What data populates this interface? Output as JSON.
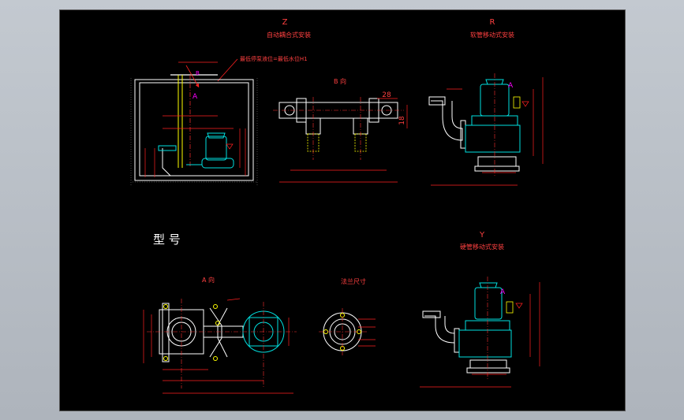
{
  "views": {
    "z": {
      "letter": "Z",
      "subtitle": "自动耦合式安装",
      "note": "最低停泵液位=最低水位H1"
    },
    "r": {
      "letter": "R",
      "subtitle": "软管移动式安装"
    },
    "y": {
      "letter": "Y",
      "subtitle": "硬管移动式安装"
    },
    "b": {
      "label": "B 向",
      "dim_28": "28",
      "dim_18": "18"
    },
    "a": {
      "label": "A 向"
    },
    "flange": {
      "label": "法兰尺寸"
    }
  },
  "model_label": "型 号",
  "colors": {
    "background": "#000000",
    "outline": "#ffffff",
    "dimension": "#ff2020",
    "center": "#ff3030",
    "pump": "#00e0e0",
    "marker": "#ffff00",
    "accent": "#ff00ff",
    "text": "#ff4040"
  }
}
